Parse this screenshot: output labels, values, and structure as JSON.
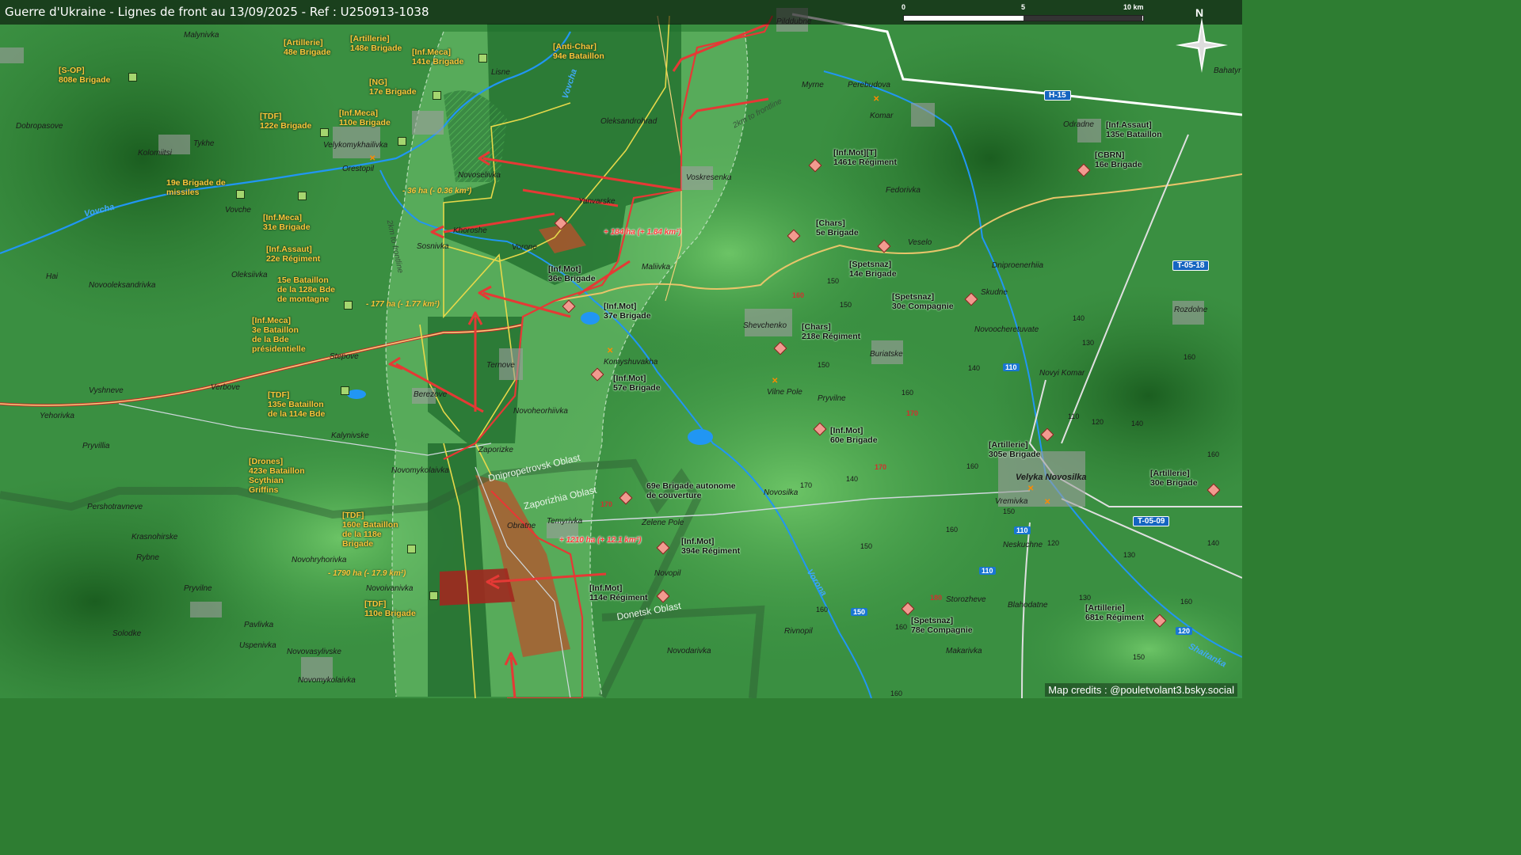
{
  "title": "Guerre d'Ukraine - Lignes de front au 13/09/2025 - Ref : U250913-1038",
  "scale_bar": {
    "labels": [
      "0",
      "5",
      "10 km"
    ]
  },
  "north": "N",
  "credits": "Map credits : @pouletvolant3.bsky.social",
  "colors": {
    "ua_unit": "#f9c53a",
    "ru_unit": "#111111",
    "front_red": "#e53935",
    "river": "#3fa9f5",
    "road_yellow": "#f3d27a",
    "terrain_dark": "#1f6b2a",
    "terrain_light": "#6fc06a"
  },
  "towns": {
    "malynivka": "Malynivka",
    "dobropasove": "Dobropasove",
    "kolomiitsi": "Kolomiitsi",
    "tykhe": "Tykhe",
    "velykomykhailivka": "Velykomykhailivka",
    "orestopil": "Orestopil",
    "vovche": "Vovche",
    "hai": "Hai",
    "novooleksandrivka": "Novooleksandrivka",
    "oleksiivka": "Oleksiivka",
    "stepove": "Stepove",
    "verbove": "Verbove",
    "vyshneve": "Vyshneve",
    "yehorivka": "Yehorivka",
    "pryvillia": "Pryvillia",
    "kalynivske": "Kalynivske",
    "novomykolaivka_n": "Novomykolaivka",
    "pershotravneve": "Pershotravneve",
    "krasnohirske": "Krasnohirske",
    "rybne": "Rybne",
    "pryvilne": "Pryvilne",
    "novohryhorivka": "Novohryhorivka",
    "novoivanivka": "Novoivanivka",
    "pavlivka": "Pavlivka",
    "solodke": "Solodke",
    "uspenivka": "Uspenivka",
    "novovasylivske": "Novovasylivske",
    "novomykolaivka_s": "Novomykolaivka",
    "lisne": "Lisne",
    "novoselivka": "Novoselivka",
    "khoroshe": "Khoroshe",
    "sosnivka": "Sosnivka",
    "vorone": "Vorone",
    "yanvarske": "Yanvarske",
    "oleksandrohrad": "Oleksandrohrad",
    "voskresenka": "Voskresenka",
    "maliivka": "Maliivka",
    "ternove": "Ternove",
    "berezove": "Berezove",
    "novoheorhiivka": "Novoheorhiivka",
    "zaporizke": "Zaporizke",
    "obratne": "Obratne",
    "temyrivka": "Temyrivka",
    "komyshuvakha": "Komyshuvakha",
    "zelene_pole": "Zelene Pole",
    "novopil": "Novopil",
    "novodarivka": "Novodarivka",
    "pilddubne": "Pilddubne",
    "myrne": "Myrne",
    "perebudova": "Perebudova",
    "komar": "Komar",
    "fedorivka": "Fedorivka",
    "veselo": "Veselo",
    "shevchenko": "Shevchenko",
    "buriatske": "Buriatske",
    "vilne_pole": "Vilne Pole",
    "pryvilne_e": "Pryvilne",
    "dniproenerhiia": "Dniproenerhiia",
    "skudne": "Skudne",
    "novoocheretuvate": "Novoocheretuvate",
    "novosilka": "Novosilka",
    "storozheve": "Storozheve",
    "makarivka": "Makarivka",
    "rivnopil": "Rivnopil",
    "odradne": "Odradne",
    "novyi_komar": "Novyi Komar",
    "rozdolne": "Rozdolne",
    "velyka_novosilka": "Velyka Novosilka",
    "vremivka": "Vremivka",
    "neskuchne": "Neskuchne",
    "blahodatne": "Blahodatne",
    "bahatyr": "Bahatyr"
  },
  "ua_units": {
    "u1": "[S-OP]\n808e Brigade",
    "u2": "[Artillerie]\n48e Brigade",
    "u3": "[Artillerie]\n148e Brigade",
    "u4": "[Inf.Meca]\n141e Brigade",
    "u5": "[Anti-Char]\n94e Bataillon",
    "u6": "[NG]\n17e Brigade",
    "u7": "[TDF]\n122e Brigade",
    "u8": "[Inf.Meca]\n110e Brigade",
    "u9": "19e Brigade de\nmissiles",
    "u10": "[Inf.Meca]\n31e Brigade",
    "u11": "[Inf.Assaut]\n22e Régiment",
    "u12": "15e Bataillon\nde la 128e Bde\nde montagne",
    "u13": "[Inf.Meca]\n3e Bataillon\nde la Bde\nprésidentielle",
    "u14": "[TDF]\n135e Bataillon\nde la 114e Bde",
    "u15": "[Drones]\n423e Bataillon\nScythian\nGriffins",
    "u16": "[TDF]\n160e Bataillon\nde la 118e\nBrigade",
    "u17": "[TDF]\n110e Brigade"
  },
  "ru_units": {
    "r1": "[Inf.Mot]\n36e Brigade",
    "r2": "[Inf.Mot]\n37e Brigade",
    "r3": "[Inf.Mot]\n57e Brigade",
    "r4": "69e Brigade autonome\nde couverture",
    "r5": "[Inf.Mot]\n394e Régiment",
    "r6": "[Inf.Mot]\n114e Régiment",
    "r7": "[Inf.Mot][T]\n1461e Régiment",
    "r8": "[Chars]\n5e Brigade",
    "r9": "[Spetsnaz]\n14e Brigade",
    "r10": "[Spetsnaz]\n30e Compagnie",
    "r11": "[Chars]\n218e Régiment",
    "r12": "[Inf.Mot]\n60e Brigade",
    "r13": "[Spetsnaz]\n78e Compagnie",
    "r14": "[Inf.Assaut]\n135e Bataillon",
    "r15": "[CBRN]\n16e Brigade",
    "r16": "[Artillerie]\n305e Brigade",
    "r17": "[Artillerie]\n30e Brigade",
    "r18": "[Artillerie]\n681e Régiment"
  },
  "area_changes": {
    "a1": "- 36 ha (- 0.36 km²)",
    "a2": "+ 184 ha (+ 1.84 km²)",
    "a3": "- 177 ha (- 1.77 km²)",
    "a4": "+ 1210 ha (+ 12.1 km²)",
    "a5": "- 1790 ha (- 17.9 km²)"
  },
  "rivers": {
    "vovcha_w": "Vovcha",
    "vovcha_n": "Vovcha",
    "vorona": "Vorona",
    "shaitanka": "Shaitanka"
  },
  "oblasts": {
    "dnipro": "Dnipropetrovsk Oblast",
    "zapo": "Zaporizhia Oblast",
    "donetsk": "Donetsk Oblast"
  },
  "rings": {
    "r_w": "2km to frontline",
    "r_ne": "2km to frontline"
  },
  "roads": {
    "h15": "H-15",
    "t0518": "T-05-18",
    "t0509": "T-05-09"
  },
  "road_numbers": {
    "n1": "110",
    "n2": "110",
    "n3": "110",
    "n4": "150",
    "n5": "120"
  },
  "elevations": {
    "e1": "150",
    "e2": "160",
    "e3": "150",
    "e4": "150",
    "e5": "160",
    "e6": "170",
    "e7": "170",
    "e8": "160",
    "e9": "140",
    "e10": "130",
    "e11": "140",
    "e12": "160",
    "e13": "110",
    "e14": "140",
    "e15": "120",
    "e16": "160",
    "e17": "160",
    "e18": "150",
    "e19": "120",
    "e20": "130",
    "e21": "140",
    "e22": "130",
    "e23": "180",
    "e24": "160",
    "e25": "150",
    "e26": "170",
    "e27": "170",
    "e28": "140",
    "e29": "160",
    "e30": "160",
    "e31": "150",
    "e32": "160"
  }
}
